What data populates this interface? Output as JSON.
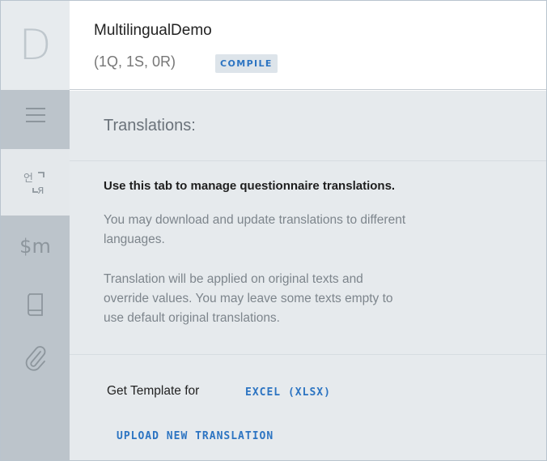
{
  "app": {
    "logo_letter": "D"
  },
  "rail": {
    "items": [
      {
        "id": "menu",
        "icon": "hamburger-menu-icon",
        "active": false
      },
      {
        "id": "translations",
        "icon": "translate-icon",
        "active": true
      },
      {
        "id": "macros",
        "icon": "macros-icon",
        "label": "$m",
        "active": false
      },
      {
        "id": "lookup-book",
        "icon": "book-icon",
        "active": false
      },
      {
        "id": "attachments",
        "icon": "paperclip-icon",
        "active": false
      }
    ]
  },
  "header": {
    "title": "MultilingualDemo",
    "counts": "(1Q, 1S, 0R)",
    "compile_label": "COMPILE"
  },
  "panel": {
    "title": "Translations:",
    "intro": "Use this tab to manage questionnaire translations.",
    "para1_line1": "You may download and update translations to different",
    "para1_line2": "languages.",
    "para2_line1": "Translation will be applied on original texts and",
    "para2_line2": "override values. You may leave some texts empty to",
    "para2_line3": "use default original translations.",
    "template_label": "Get Template for",
    "excel_link": "EXCEL (XLSX)",
    "upload_link": "UPLOAD NEW TRANSLATION"
  },
  "colors": {
    "accent": "#2c74c2",
    "rail_bg": "#bcc4cb",
    "content_bg": "#e6eaed"
  }
}
